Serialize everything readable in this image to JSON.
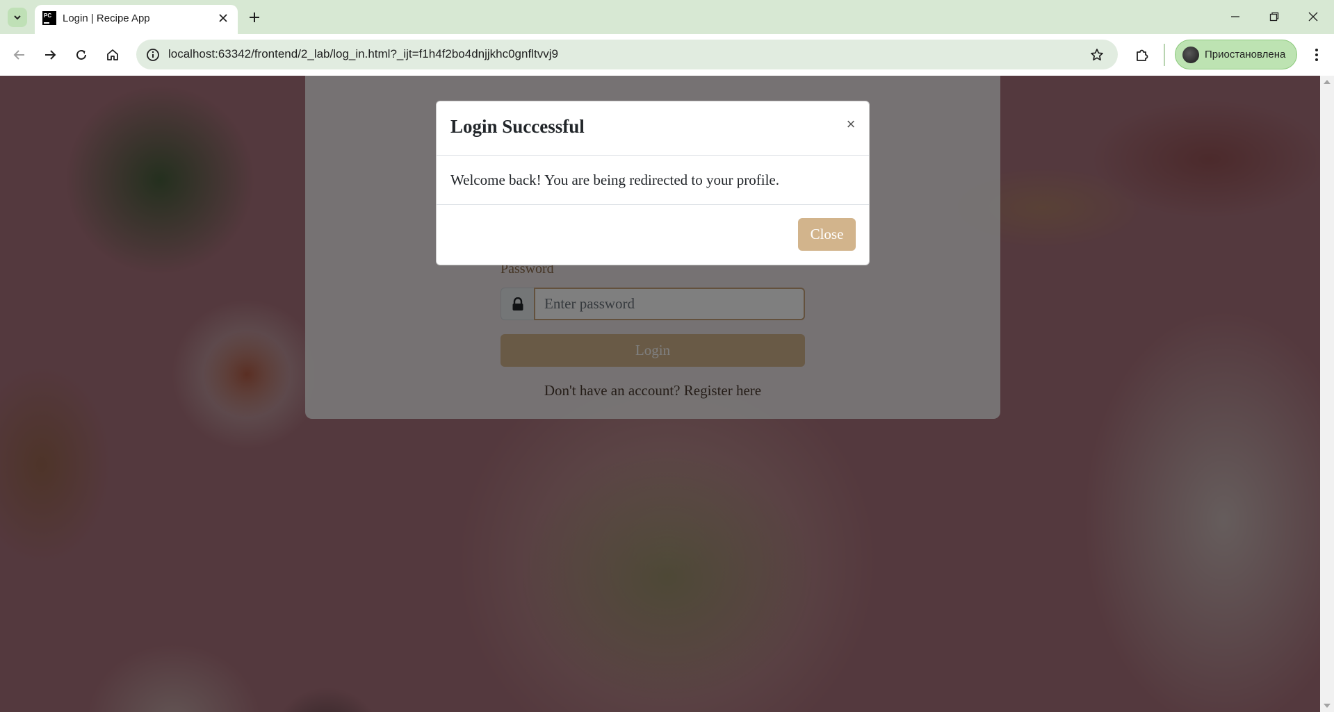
{
  "browser": {
    "tab_title": "Login | Recipe App",
    "favicon_text": "PC",
    "url": "localhost:63342/frontend/2_lab/log_in.html?_ijt=f1h4f2bo4dnjjkhc0gnfltvvj9",
    "profile_label": "Приостановлена",
    "icons": {
      "tab_search": "chevron-down-icon",
      "tab_close": "close-icon",
      "new_tab": "plus-icon",
      "minimize": "minimize-icon",
      "restore": "restore-icon",
      "window_close": "close-icon",
      "back": "arrow-left-icon",
      "forward": "arrow-right-icon",
      "reload": "reload-icon",
      "home": "home-icon",
      "site_info": "info-icon",
      "bookmark": "star-icon",
      "extensions": "puzzle-icon",
      "menu": "kebab-menu-icon"
    }
  },
  "login_form": {
    "password_label": "Password",
    "password_placeholder": "Enter password",
    "login_button": "Login",
    "register_text": "Don't have an account? Register here",
    "lock_icon": "lock-icon"
  },
  "modal": {
    "title": "Login Successful",
    "close_x": "×",
    "message": "Welcome back! You are being redirected to your profile.",
    "close_button": "Close"
  },
  "colors": {
    "accent": "#d2b48c",
    "browser_frame": "#d7e8d3",
    "backdrop": "rgba(0,0,0,0.5)"
  }
}
